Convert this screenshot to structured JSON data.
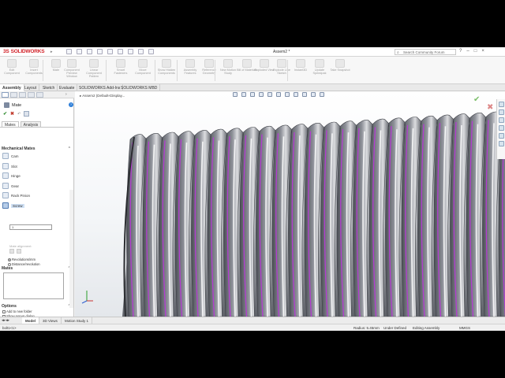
{
  "app": {
    "brand": "SOLIDWORKS",
    "brand_prefix": "3S",
    "document_title": "Assem2 *",
    "search_placeholder": "Search Community Forum"
  },
  "commands": [
    {
      "label": "Edit Component"
    },
    {
      "label": "Insert Components"
    },
    {
      "label": "Mate"
    },
    {
      "label": "Component Preview Window"
    },
    {
      "label": "Linear Component Pattern"
    },
    {
      "label": "Smart Fasteners"
    },
    {
      "label": "Move Component"
    },
    {
      "label": "Show Hidden Components"
    },
    {
      "label": "Assembly Features"
    },
    {
      "label": "Reference Geometry"
    },
    {
      "label": "New Motion Study"
    },
    {
      "label": "Bill of Materials"
    },
    {
      "label": "Exploded View"
    },
    {
      "label": "Explode Line Sketch"
    },
    {
      "label": "Instant3D"
    },
    {
      "label": "Update Speedpak"
    },
    {
      "label": "Take Snapshot"
    }
  ],
  "tabs": [
    "Assembly",
    "Layout",
    "Sketch",
    "Evaluate",
    "SOLIDWORKS Add-Ins",
    "SOLIDWORKS MBD"
  ],
  "property_manager": {
    "title": "Mate",
    "tabs": [
      "Mates",
      "Analysis"
    ],
    "mechanical_mates_heading": "Mechanical Mates",
    "mate_types": [
      "Cam",
      "Slot",
      "Hinge",
      "Gear",
      "Rack Pinion",
      "Screw"
    ],
    "selected_mate": "Screw",
    "radio_options": [
      "Revolutions/mm",
      "Distance/revolution"
    ],
    "value": "1",
    "reverse_label": "Reverse",
    "universal_joint_label": "Universal Joint",
    "alignment_label": "Mate alignment:",
    "mates_heading": "Mates",
    "options_heading": "Options",
    "option_items": [
      "Add to new folder",
      "Show popup dialog"
    ]
  },
  "viewport": {
    "breadcrumb": "Assem2 (Default<Display..."
  },
  "bottom_tabs": [
    "Model",
    "3D Views",
    "Motion Study 1"
  ],
  "status": {
    "left": "bolt1<1>",
    "radius": "Radius: 5.45mm",
    "definition": "Under Defined",
    "mode": "Editing Assembly",
    "units": "MMGS"
  },
  "colors": {
    "accent": "#d2232a",
    "thread_edge": "#b43cd2",
    "thread_body": "#7a7d84"
  }
}
